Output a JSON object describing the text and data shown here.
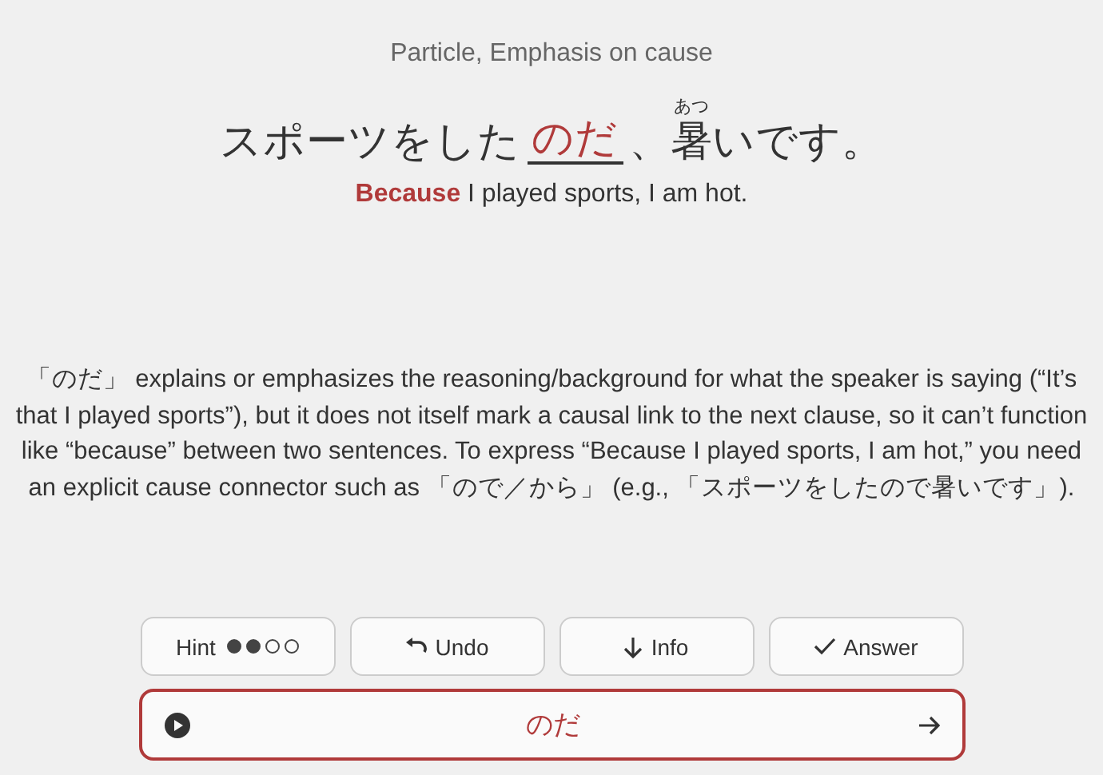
{
  "category": "Particle, Emphasis on cause",
  "sentence": [
    {
      "kind": "text",
      "text": "スポーツをした"
    },
    {
      "kind": "blank",
      "text": "のだ"
    },
    {
      "kind": "text",
      "text": "、"
    },
    {
      "kind": "ruby",
      "text": "暑",
      "reading": "あつ"
    },
    {
      "kind": "text",
      "text": "いです。"
    }
  ],
  "translation": "**Because** I played sports, I am hot.",
  "explanation": "「のだ」 explains or emphasizes the reasoning/background for what the speaker is saying (“It’s that I played sports”), but it does not itself mark a causal link to the next clause, so it can’t function like “because” between two sentences. To express “Because I played sports, I am hot,” you need an explicit cause connector such as 「ので／から」 (e.g., 「スポーツをしたので暑いです」).",
  "buttons": [
    {
      "kind": "hint",
      "label": "Hint",
      "dots": [
        {
          "filled": true
        },
        {
          "filled": true
        },
        {
          "filled": false
        },
        {
          "filled": false
        }
      ]
    },
    {
      "kind": "undo",
      "label": "Undo"
    },
    {
      "kind": "info",
      "label": "Info"
    },
    {
      "kind": "answer",
      "label": "Answer"
    }
  ],
  "answer": {
    "text": "のだ"
  }
}
